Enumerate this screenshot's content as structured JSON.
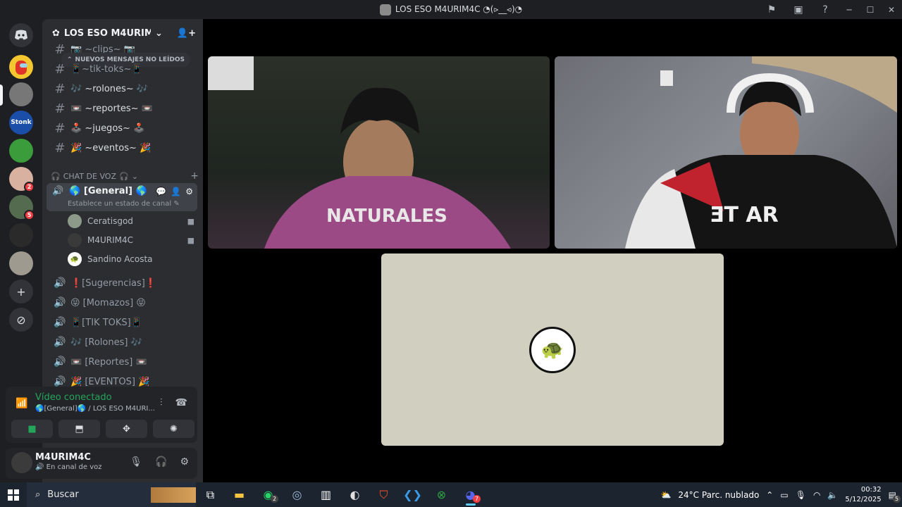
{
  "titlebar": {
    "title": "LOS ESO M4URIM4C ◔(⪧__⪦)◔"
  },
  "server": {
    "name": "LOS ESO M4URIM4C ..."
  },
  "unread_banner": "NUEVOS MENSAJES NO LEÍDOS",
  "text_channels": [
    "📷 ~clips~ 📷",
    "📱~tik-toks~📱",
    "🎶 ~rolones~ 🎶",
    "📼 ~reportes~ 📼",
    "🕹️ ~juegos~ 🕹️",
    "🎉 ~eventos~ 🎉"
  ],
  "voice_category": "CHAT DE VOZ",
  "active_voice": {
    "name": "🌎 [General] 🌎",
    "status_placeholder": "Establece un estado de canal"
  },
  "voice_users": [
    "Ceratisgod",
    "M4URIM4C",
    "Sandino Acosta"
  ],
  "voice_channels": [
    "❗[Sugerencias]❗",
    "😝 [Momazos] 😝",
    "📱[TIK TOKS]📱",
    "🎶 [Rolones] 🎶",
    "📼 [Reportes] 📼",
    "🎉 [EVENTOS] 🎉"
  ],
  "guild_badges": [
    "2",
    "5"
  ],
  "voice_panel": {
    "status": "Vídeo conectado",
    "sub": "🌎[General]🌎 / LOS ESO M4URI..."
  },
  "user_panel": {
    "name": "M4URIM4C",
    "status": "En canal de voz"
  },
  "taskbar": {
    "search_placeholder": "Buscar",
    "whatsapp_badge": "2",
    "discord_badge": "7",
    "weather": "24°C  Parc. nublado",
    "time": "00:32",
    "date": "5/12/2025",
    "notif_count": "5"
  },
  "colors": {
    "online": "#23a55a",
    "badge": "#f23f43",
    "accent": "#5865f2"
  }
}
